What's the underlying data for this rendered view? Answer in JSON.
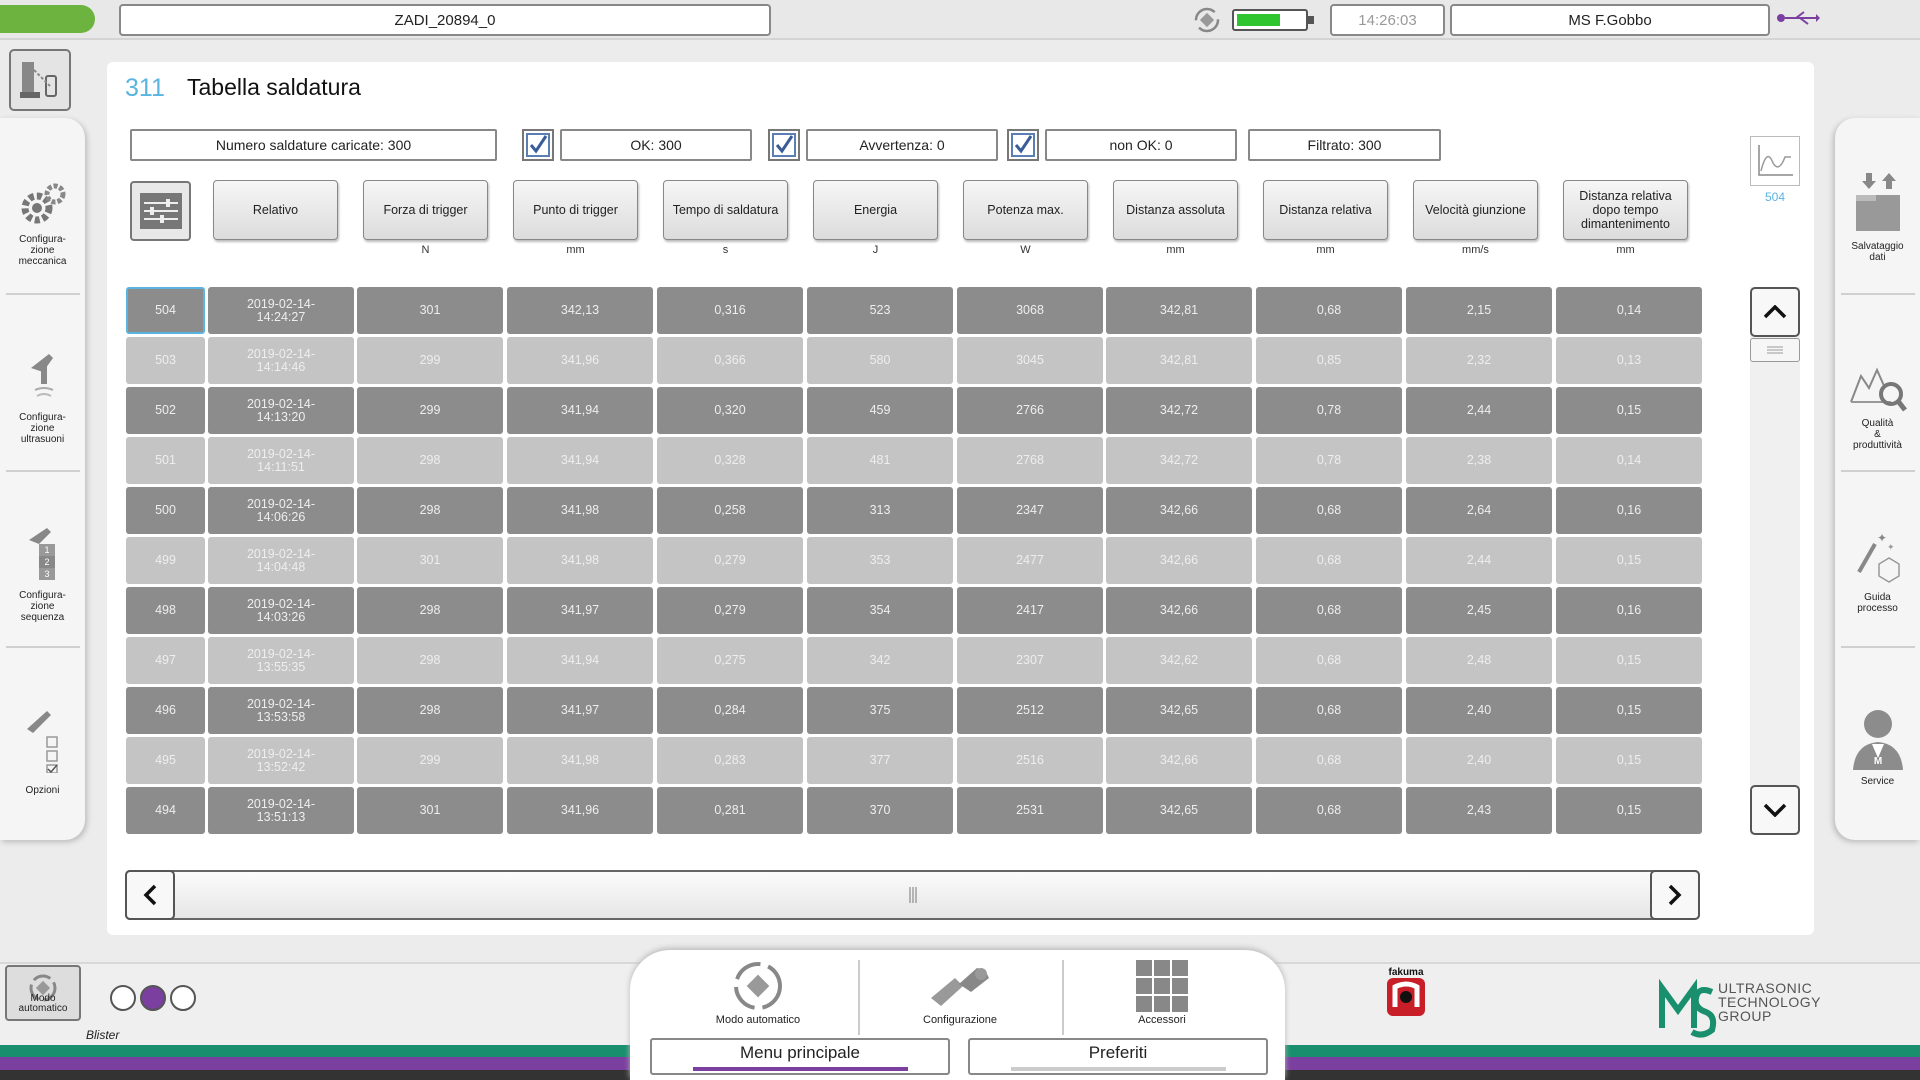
{
  "topbar": {
    "job_name": "ZADI_20894_0",
    "time": "14:26:03",
    "user": "MS F.Gobbo",
    "battery_level": 0.65
  },
  "screen": {
    "number": "311",
    "title": "Tabella saldatura"
  },
  "summary": {
    "loaded": "Numero saldature caricate: 300",
    "ok": "OK: 300",
    "warning": "Avvertenza: 0",
    "not_ok": "non OK: 0",
    "filtered": "Filtrato: 300"
  },
  "columns": [
    {
      "label": "Relativo",
      "unit": ""
    },
    {
      "label": "Forza di trigger",
      "unit": "N"
    },
    {
      "label": "Punto di trigger",
      "unit": "mm"
    },
    {
      "label": "Tempo di saldatura",
      "unit": "s"
    },
    {
      "label": "Energia",
      "unit": "J"
    },
    {
      "label": "Potenza max.",
      "unit": "W"
    },
    {
      "label": "Distanza assoluta",
      "unit": "mm"
    },
    {
      "label": "Distanza relativa",
      "unit": "mm"
    },
    {
      "label": "Velocità giunzione",
      "unit": "mm/s"
    },
    {
      "label": "Distanza relativa dopo tempo dimantenimento",
      "unit": "mm"
    }
  ],
  "rows": [
    {
      "id": "504",
      "time": "2019-02-14-\n14:24:27",
      "v": [
        "301",
        "342,13",
        "0,316",
        "523",
        "3068",
        "342,81",
        "0,68",
        "2,15",
        "0,14"
      ]
    },
    {
      "id": "503",
      "time": "2019-02-14-\n14:14:46",
      "v": [
        "299",
        "341,96",
        "0,366",
        "580",
        "3045",
        "342,81",
        "0,85",
        "2,32",
        "0,13"
      ]
    },
    {
      "id": "502",
      "time": "2019-02-14-\n14:13:20",
      "v": [
        "299",
        "341,94",
        "0,320",
        "459",
        "2766",
        "342,72",
        "0,78",
        "2,44",
        "0,15"
      ]
    },
    {
      "id": "501",
      "time": "2019-02-14-\n14:11:51",
      "v": [
        "298",
        "341,94",
        "0,328",
        "481",
        "2768",
        "342,72",
        "0,78",
        "2,38",
        "0,14"
      ]
    },
    {
      "id": "500",
      "time": "2019-02-14-\n14:06:26",
      "v": [
        "298",
        "341,98",
        "0,258",
        "313",
        "2347",
        "342,66",
        "0,68",
        "2,64",
        "0,16"
      ]
    },
    {
      "id": "499",
      "time": "2019-02-14-\n14:04:48",
      "v": [
        "301",
        "341,98",
        "0,279",
        "353",
        "2477",
        "342,66",
        "0,68",
        "2,44",
        "0,15"
      ]
    },
    {
      "id": "498",
      "time": "2019-02-14-\n14:03:26",
      "v": [
        "298",
        "341,97",
        "0,279",
        "354",
        "2417",
        "342,66",
        "0,68",
        "2,45",
        "0,16"
      ]
    },
    {
      "id": "497",
      "time": "2019-02-14-\n13:55:35",
      "v": [
        "298",
        "341,94",
        "0,275",
        "342",
        "2307",
        "342,62",
        "0,68",
        "2,48",
        "0,15"
      ]
    },
    {
      "id": "496",
      "time": "2019-02-14-\n13:53:58",
      "v": [
        "298",
        "341,97",
        "0,284",
        "375",
        "2512",
        "342,65",
        "0,68",
        "2,40",
        "0,15"
      ]
    },
    {
      "id": "495",
      "time": "2019-02-14-\n13:52:42",
      "v": [
        "299",
        "341,98",
        "0,283",
        "377",
        "2516",
        "342,66",
        "0,68",
        "2,40",
        "0,15"
      ]
    },
    {
      "id": "494",
      "time": "2019-02-14-\n13:51:13",
      "v": [
        "301",
        "341,96",
        "0,281",
        "370",
        "2531",
        "342,65",
        "0,68",
        "2,43",
        "0,15"
      ]
    }
  ],
  "graph_count": "504",
  "left_sidebar": [
    {
      "label": "Configura-\nzione\nmeccanica",
      "icon": "gears-icon"
    },
    {
      "label": "Configura-\nzione\nultrasuoni",
      "icon": "sonotrode-icon"
    },
    {
      "label": "Configura-\nzione\nsequenza",
      "icon": "sequence-icon"
    },
    {
      "label": "Opzioni",
      "icon": "options-icon"
    }
  ],
  "right_sidebar": [
    {
      "label": "Salvataggio\ndati",
      "icon": "data-save-icon"
    },
    {
      "label": "Qualità\n&\nproduttività",
      "icon": "quality-icon"
    },
    {
      "label": "Guida\nprocesso",
      "icon": "process-guide-icon"
    },
    {
      "label": "Service",
      "icon": "service-icon"
    }
  ],
  "bottom": {
    "mode_label": "Modo\nautomatico",
    "material": "Blister",
    "nav_items": [
      "Modo automatico",
      "Configurazione",
      "Accessori"
    ],
    "tab_main": "Menu principale",
    "tab_fav": "Preferiti",
    "fair_logo": "fakuma",
    "brand": "ULTRASONIC\nTECHNOLOGY\nGROUP"
  },
  "colors": {
    "accent_blue": "#5ab4e0",
    "purple": "#7b3fa0",
    "green": "#6db33f",
    "teal": "#1a8f6e"
  }
}
